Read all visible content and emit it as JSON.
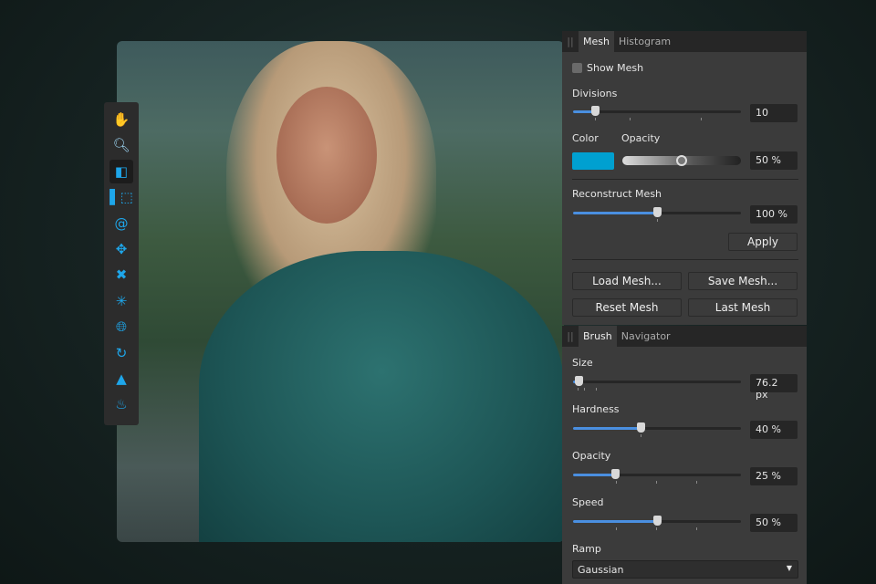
{
  "toolbar": {
    "tools": [
      "hand-tool",
      "zoom-tool",
      "push-forward-tool",
      "push-left-tool",
      "twirl-tool",
      "pinch-tool",
      "punch-tool",
      "turbulence-tool",
      "mesh-clone-tool",
      "reconstruct-tool",
      "freeze-tool",
      "thaw-tool"
    ],
    "active": 2
  },
  "mesh_panel": {
    "tabs": [
      "Mesh",
      "Histogram"
    ],
    "show_mesh_label": "Show Mesh",
    "show_mesh": false,
    "divisions_label": "Divisions",
    "divisions_value": "10",
    "divisions_fraction": 0.13,
    "color_label": "Color",
    "color": "#00a0d0",
    "opacity_label": "Opacity",
    "opacity_value": "50 %",
    "opacity_fraction": 0.5,
    "reconstruct_label": "Reconstruct Mesh",
    "reconstruct_value": "100 %",
    "reconstruct_fraction": 0.5,
    "apply": "Apply",
    "load": "Load Mesh...",
    "save": "Save Mesh...",
    "reset": "Reset Mesh",
    "last": "Last Mesh"
  },
  "brush_panel": {
    "tabs": [
      "Brush",
      "Navigator"
    ],
    "size_label": "Size",
    "size_value": "76.2 px",
    "size_fraction": 0.03,
    "hardness_label": "Hardness",
    "hardness_value": "40 %",
    "hardness_fraction": 0.4,
    "opacity_label": "Opacity",
    "opacity_value": "25 %",
    "opacity_fraction": 0.25,
    "speed_label": "Speed",
    "speed_value": "50 %",
    "speed_fraction": 0.5,
    "ramp_label": "Ramp",
    "ramp_value": "Gaussian"
  },
  "accent": "#4a8fe0"
}
